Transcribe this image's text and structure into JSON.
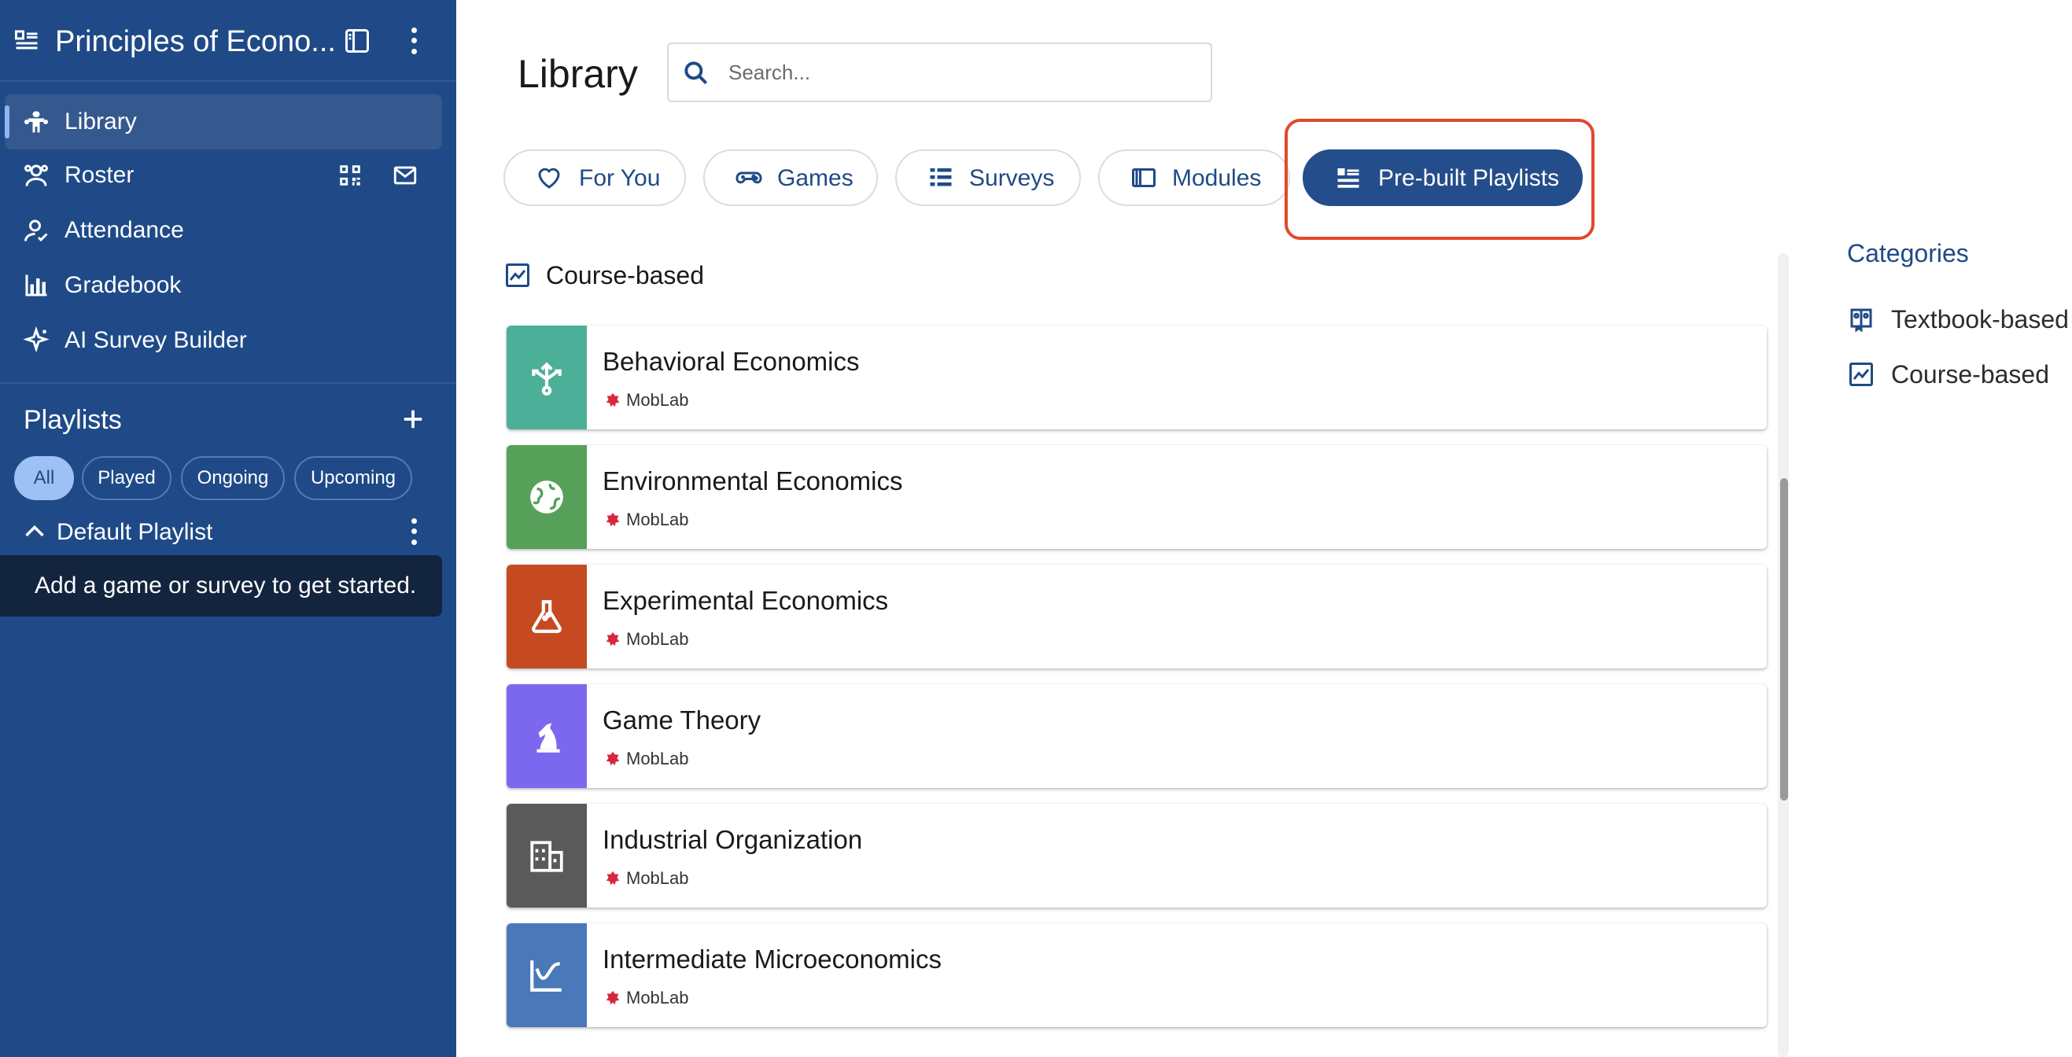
{
  "sidebar": {
    "course_title": "Principles of Econo...",
    "nav": [
      {
        "label": "Library",
        "icon": "library-icon"
      },
      {
        "label": "Roster",
        "icon": "roster-icon"
      },
      {
        "label": "Attendance",
        "icon": "attendance-icon"
      },
      {
        "label": "Gradebook",
        "icon": "gradebook-icon"
      },
      {
        "label": "AI Survey Builder",
        "icon": "sparkle-icon"
      }
    ],
    "playlists_title": "Playlists",
    "filters": [
      "All",
      "Played",
      "Ongoing",
      "Upcoming"
    ],
    "selected_filter": "All",
    "default_playlist": "Default Playlist",
    "empty_message": "Add a game or survey to get started."
  },
  "main": {
    "page_title": "Library",
    "search_placeholder": "Search...",
    "tabs": [
      {
        "label": "For You",
        "icon": "heart-icon"
      },
      {
        "label": "Games",
        "icon": "gamepad-icon"
      },
      {
        "label": "Surveys",
        "icon": "list-icon"
      },
      {
        "label": "Modules",
        "icon": "module-icon"
      },
      {
        "label": "Pre-built Playlists",
        "icon": "playlist-icon"
      }
    ],
    "selected_tab": "Pre-built Playlists",
    "section_title": "Course-based",
    "playlists": [
      {
        "title": "Behavioral Economics",
        "provider": "MobLab",
        "color": "#4caf98",
        "icon": "split-arrows-icon"
      },
      {
        "title": "Environmental Economics",
        "provider": "MobLab",
        "color": "#57a05a",
        "icon": "globe-icon"
      },
      {
        "title": "Experimental Economics",
        "provider": "MobLab",
        "color": "#c54a21",
        "icon": "flask-icon"
      },
      {
        "title": "Game Theory",
        "provider": "MobLab",
        "color": "#7b68ee",
        "icon": "chess-knight-icon"
      },
      {
        "title": "Industrial Organization",
        "provider": "MobLab",
        "color": "#5a5a5a",
        "icon": "building-icon"
      },
      {
        "title": "Intermediate Microeconomics",
        "provider": "MobLab",
        "color": "#4a78b8",
        "icon": "curve-icon"
      }
    ],
    "categories_title": "Categories",
    "categories": [
      {
        "label": "Textbook-based",
        "icon": "textbook-icon"
      },
      {
        "label": "Course-based",
        "icon": "chart-icon"
      }
    ]
  },
  "colors": {
    "sidebar_bg": "#1f4a87",
    "accent": "#244d8b",
    "highlight": "#e2482d",
    "brand_red": "#d6283c"
  }
}
